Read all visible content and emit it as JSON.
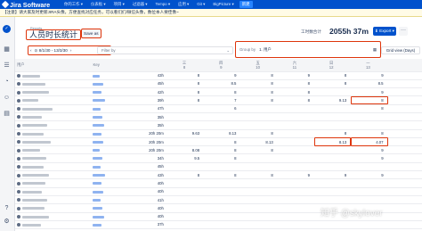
{
  "app": {
    "name": "Jira Software"
  },
  "nav": {
    "items": [
      "你的工作 ▾",
      "仪表板 ▾",
      "项目 ▾",
      "过滤器 ▾",
      "Tempo ▾",
      "应用 ▾",
      "Git ▾",
      "BigPicture ▾"
    ],
    "create": "新建"
  },
  "banner": {
    "text": "【注意】请大家及时更新JIRA头像，方便查找对应任务，可以看们们/微信头像，数位本人要佳像~"
  },
  "report": {
    "breadcrumb": "Reports",
    "title": "人员时长统计",
    "save_label": "Save as",
    "total_label": "工时数合计",
    "total_value": "2055h 37m",
    "export_label": "⬇ Export ▾",
    "more_label": "···"
  },
  "toolbar": {
    "date_range": "⊙ 8/1/30 - 13/3/30",
    "filter_label": "Filter by",
    "group_label": "Group by",
    "group_value": "1. 用户",
    "grid_view_label": "Grid view (Days)"
  },
  "table": {
    "headers": {
      "user": "用户",
      "key": "Key",
      "days": [
        {
          "weekday": "三",
          "day": "8"
        },
        {
          "weekday": "四",
          "day": "9"
        },
        {
          "weekday": "五",
          "day": "10"
        },
        {
          "weekday": "六",
          "day": "11"
        },
        {
          "weekday": "日",
          "day": "12"
        },
        {
          "weekday": "一",
          "day": "13"
        }
      ]
    },
    "rows": [
      {
        "total": "43h",
        "days": [
          "8",
          "9",
          "8",
          "9",
          "8",
          "9"
        ]
      },
      {
        "total": "45h",
        "days": [
          "8",
          "8.5",
          "8",
          "8",
          "8",
          "8.5"
        ]
      },
      {
        "total": "42h",
        "days": [
          "8",
          "8",
          "8",
          "8",
          "",
          "9"
        ]
      },
      {
        "total": "39h",
        "days": [
          "8",
          "7",
          "8",
          "8",
          "9.13",
          "8"
        ]
      },
      {
        "total": "47h",
        "days": [
          "",
          "6",
          "",
          "",
          "",
          "8"
        ]
      },
      {
        "total": "35h",
        "days": [
          "",
          "",
          "",
          "",
          "",
          ""
        ]
      },
      {
        "total": "35h",
        "days": [
          "",
          "",
          "",
          "",
          "",
          ""
        ]
      },
      {
        "total": "20h 20m",
        "days": [
          "9.63",
          "8.13",
          "8",
          "",
          "8",
          "8"
        ]
      },
      {
        "total": "20h 20m",
        "days": [
          "",
          "8",
          "8.13",
          "",
          "8.13",
          "4.07"
        ]
      },
      {
        "total": "20h 20m",
        "days": [
          "8.08",
          "8",
          "8",
          "",
          "",
          "9"
        ]
      },
      {
        "total": "34h",
        "days": [
          "9.5",
          "8",
          "",
          "",
          "",
          "9"
        ]
      },
      {
        "total": "45h",
        "days": [
          "",
          "",
          "",
          "",
          "",
          ""
        ]
      },
      {
        "total": "43h",
        "days": [
          "8",
          "8",
          "8",
          "9",
          "9",
          "9"
        ]
      },
      {
        "total": "40h",
        "days": [
          "",
          "",
          "",
          "",
          "",
          ""
        ]
      },
      {
        "total": "40h",
        "days": [
          "",
          "",
          "",
          "",
          "",
          ""
        ]
      },
      {
        "total": "41h",
        "days": [
          "",
          "",
          "",
          "",
          "",
          ""
        ]
      },
      {
        "total": "40h",
        "days": [
          "",
          "",
          "",
          "",
          "",
          ""
        ]
      },
      {
        "total": "40h",
        "days": [
          "",
          "",
          "",
          "",
          "",
          ""
        ]
      },
      {
        "total": "37h",
        "days": [
          "",
          "",
          "",
          "",
          "",
          ""
        ]
      }
    ]
  },
  "footer": {
    "watermark": "知乎 @skylover"
  },
  "colors": {
    "nav": "#0052cc",
    "highlight": "#de350b",
    "banner": "#fffbe6"
  }
}
